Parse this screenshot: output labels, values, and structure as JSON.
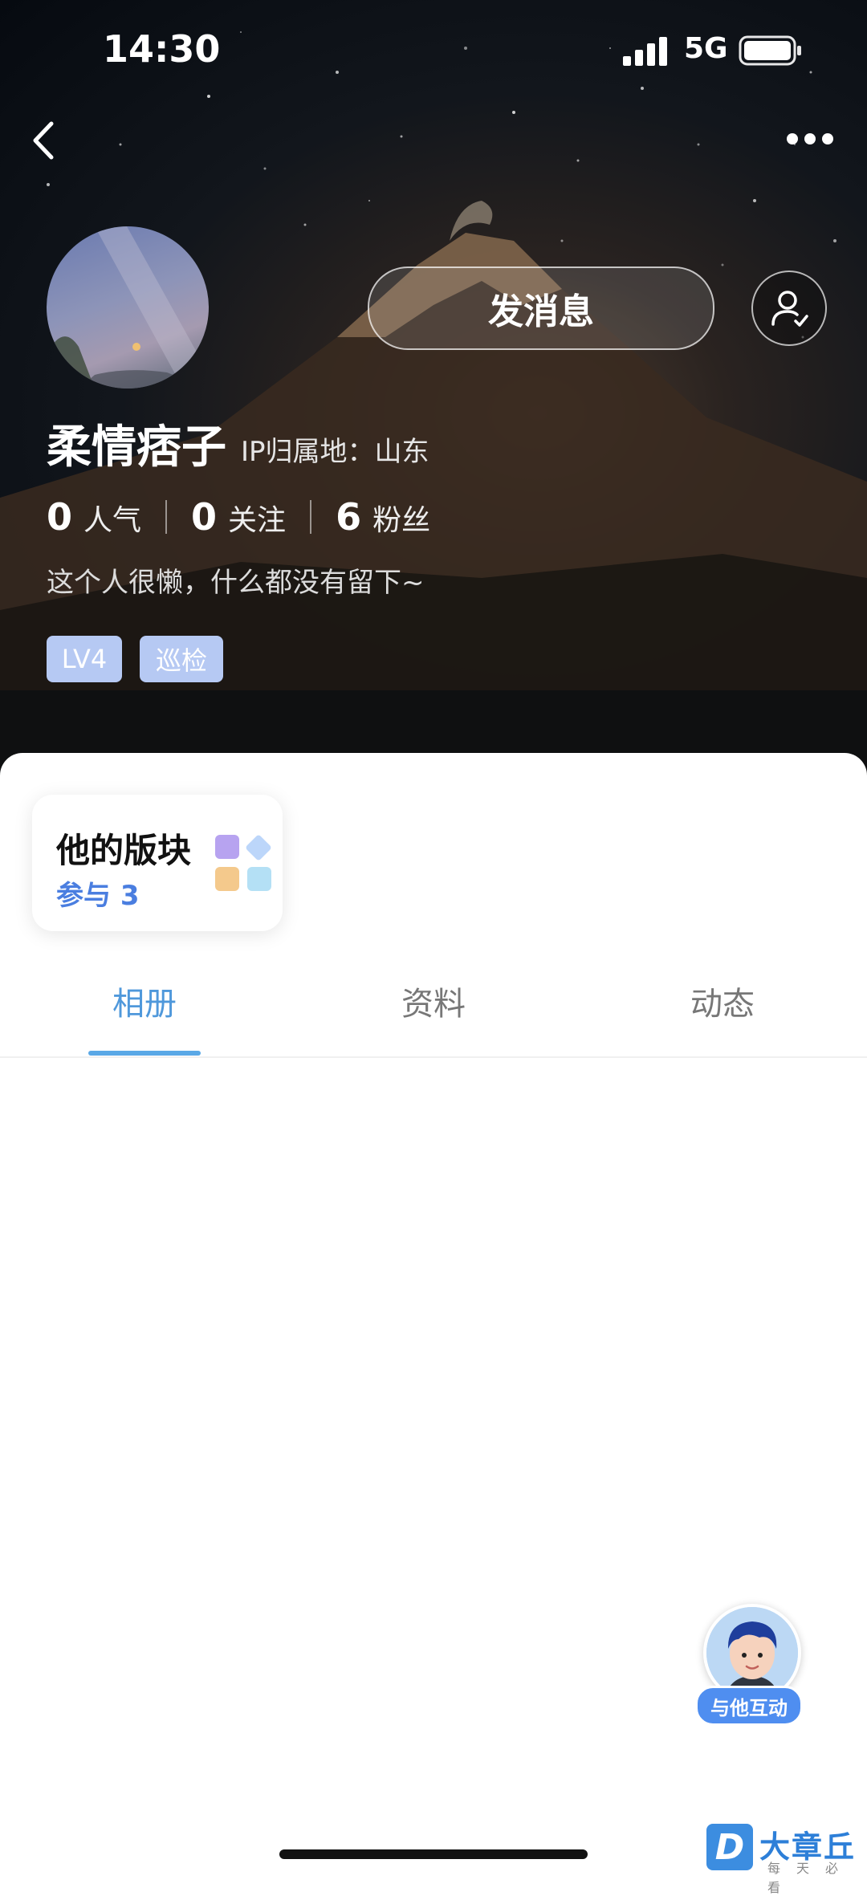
{
  "status_bar": {
    "time": "14:30",
    "network": "5G"
  },
  "profile": {
    "name": "柔情痞子",
    "ip_location": "IP归属地：山东",
    "message_button": "发消息",
    "bio": "这个人很懒，什么都没有留下~",
    "stats": [
      {
        "value": "0",
        "label": "人气"
      },
      {
        "value": "0",
        "label": "关注"
      },
      {
        "value": "6",
        "label": "粉丝"
      }
    ],
    "badges": [
      "LV4",
      "巡检"
    ]
  },
  "section_card": {
    "title": "他的版块",
    "subtitle": "参与 3"
  },
  "tabs": [
    {
      "label": "相册",
      "active": true
    },
    {
      "label": "资料",
      "active": false
    },
    {
      "label": "动态",
      "active": false
    }
  ],
  "fab": {
    "label": "与他互动"
  },
  "watermark": {
    "title": "大章丘",
    "subtitle": "每天必看"
  },
  "colors": {
    "accent_blue": "#4f98db",
    "badge_bg": "#b6c9f3",
    "card_sub": "#4a7ee0"
  }
}
